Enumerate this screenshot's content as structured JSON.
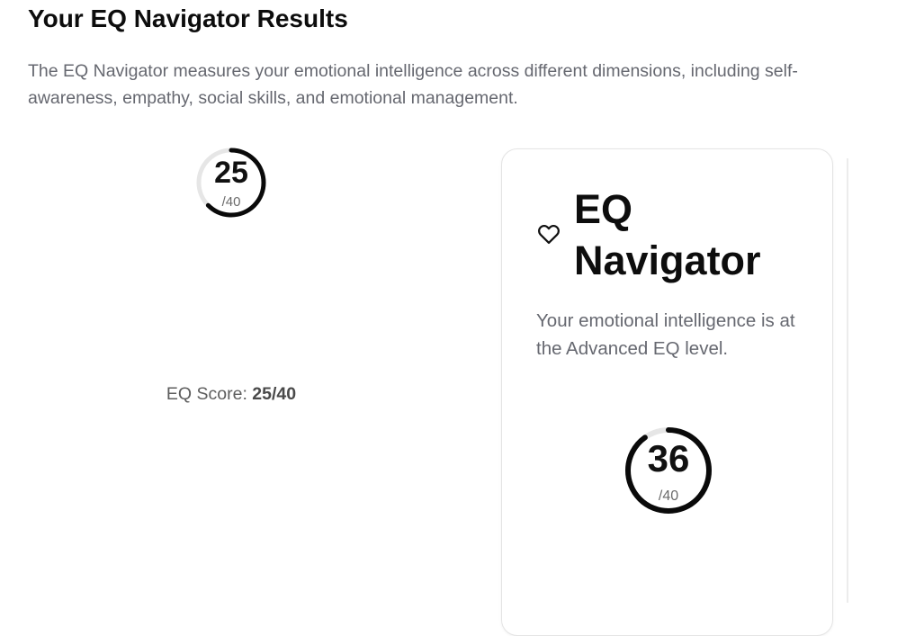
{
  "header": {
    "title": "Your EQ Navigator Results",
    "description": "The EQ Navigator measures your emotional intelligence across different dimensions, including self-awareness, empathy, social skills, and emotional management."
  },
  "summary": {
    "score": "25",
    "max": "/40",
    "progress_fraction": 0.625,
    "score_label": "EQ Score:",
    "score_value": "25/40"
  },
  "card": {
    "icon": "heart-icon",
    "title_line1": "EQ",
    "title_line2": "Navigator",
    "description": "Your emotional intelligence is at the Advanced EQ level.",
    "score": "36",
    "max": "/40",
    "progress_fraction": 0.9
  },
  "colors": {
    "ring_track": "#e6e6e6",
    "ring_fill": "#0a0a0a",
    "muted_text": "#666870"
  }
}
